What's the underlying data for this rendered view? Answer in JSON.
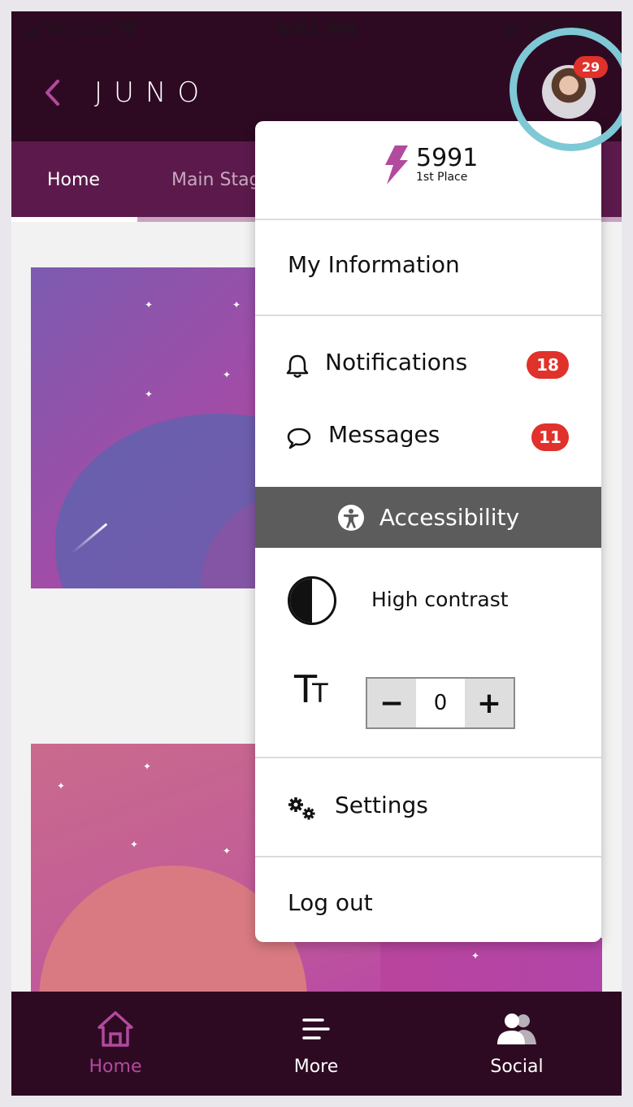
{
  "status_bar": {
    "carrier": "Verizon",
    "time": "4:41 PM",
    "battery": "54%"
  },
  "header": {
    "logo": "JUNO",
    "avatar_badge": "29"
  },
  "tabs": [
    {
      "label": "Home"
    },
    {
      "label": "Main Stag"
    }
  ],
  "menu": {
    "score": "5991",
    "rank": "1st Place",
    "my_information": "My Information",
    "notifications": {
      "label": "Notifications",
      "count": "18"
    },
    "messages": {
      "label": "Messages",
      "count": "11"
    },
    "accessibility": "Accessibility",
    "high_contrast": "High contrast",
    "text_size": {
      "value": "0",
      "minus": "−",
      "plus": "+"
    },
    "settings": "Settings",
    "logout": "Log out"
  },
  "bottom_nav": {
    "home": "Home",
    "more": "More",
    "social": "Social"
  },
  "colors": {
    "header_bg": "#2d0a22",
    "tab_bg": "#5c1a4c",
    "accent": "#b24a9e",
    "badge": "#e0312b",
    "ring": "#7fc8d6"
  }
}
